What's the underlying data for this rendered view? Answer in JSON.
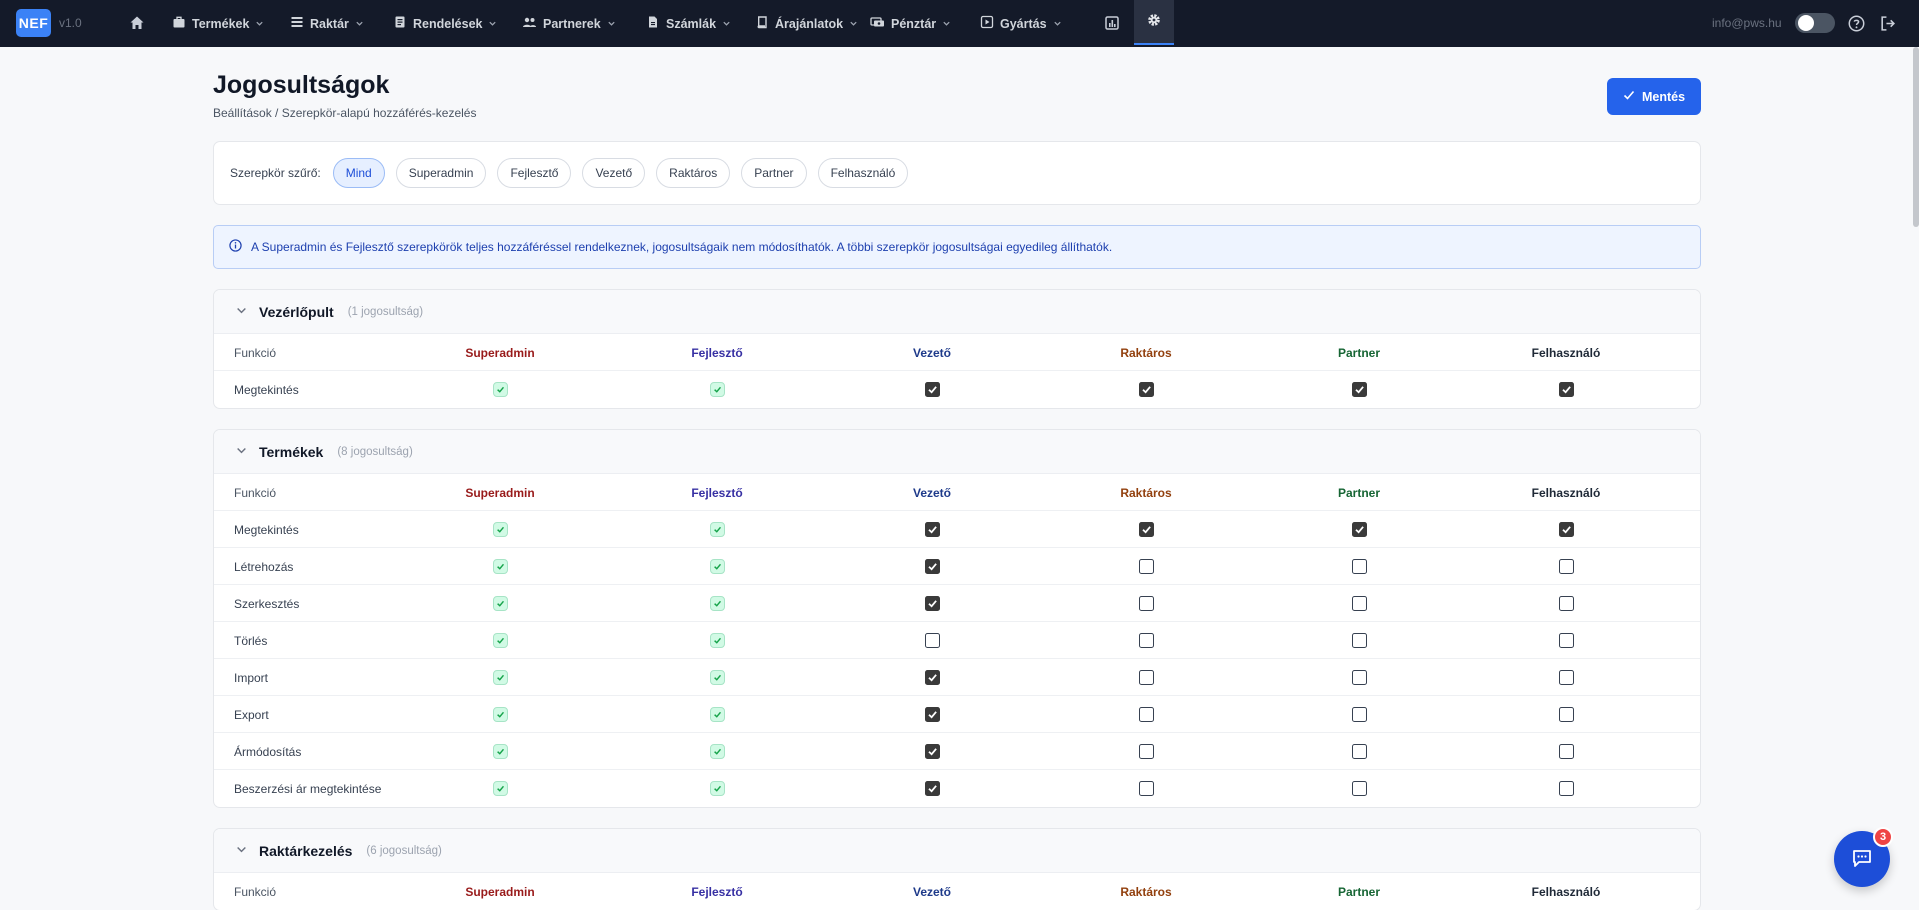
{
  "nav": {
    "logo": "NEF",
    "version": "v1.0",
    "items": [
      {
        "label": "Termékek",
        "icon": "box-icon"
      },
      {
        "label": "Raktár",
        "icon": "list-icon"
      },
      {
        "label": "Rendelések",
        "icon": "document-icon"
      },
      {
        "label": "Partnerek",
        "icon": "users-icon"
      },
      {
        "label": "Számlák",
        "icon": "file-icon"
      },
      {
        "label": "Árajánlatok",
        "icon": "book-icon"
      },
      {
        "label": "Pénztár",
        "icon": "cash-icon"
      },
      {
        "label": "Gyártás",
        "icon": "play-icon"
      }
    ],
    "user_email": "info@pws.hu"
  },
  "page": {
    "title": "Jogosultságok",
    "breadcrumb": "Beállítások / Szerepkör-alapú hozzáférés-kezelés",
    "save_label": "Mentés"
  },
  "filter": {
    "label": "Szerepkör szűrő:",
    "chips": [
      "Mind",
      "Superadmin",
      "Fejlesztő",
      "Vezető",
      "Raktáros",
      "Partner",
      "Felhasználó"
    ],
    "active": "Mind"
  },
  "info_text": "A Superadmin és Fejlesztő szerepkörök teljes hozzáféréssel rendelkeznek, jogosultságaik nem módosíthatók. A többi szerepkör jogosultságai egyedileg állíthatók.",
  "table_header": {
    "func": "Funkció",
    "roles": [
      "Superadmin",
      "Fejlesztő",
      "Vezető",
      "Raktáros",
      "Partner",
      "Felhasználó"
    ]
  },
  "sections": [
    {
      "title": "Vezérlőpult",
      "count": "(1 jogosultság)",
      "rows": [
        {
          "label": "Megtekintés",
          "vezeto": true,
          "raktaros": true,
          "partner": true,
          "felhasznalo": true
        }
      ]
    },
    {
      "title": "Termékek",
      "count": "(8 jogosultság)",
      "rows": [
        {
          "label": "Megtekintés",
          "vezeto": true,
          "raktaros": true,
          "partner": true,
          "felhasznalo": true
        },
        {
          "label": "Létrehozás",
          "vezeto": true,
          "raktaros": false,
          "partner": false,
          "felhasznalo": false
        },
        {
          "label": "Szerkesztés",
          "vezeto": true,
          "raktaros": false,
          "partner": false,
          "felhasznalo": false
        },
        {
          "label": "Törlés",
          "vezeto": false,
          "raktaros": false,
          "partner": false,
          "felhasznalo": false
        },
        {
          "label": "Import",
          "vezeto": true,
          "raktaros": false,
          "partner": false,
          "felhasznalo": false
        },
        {
          "label": "Export",
          "vezeto": true,
          "raktaros": false,
          "partner": false,
          "felhasznalo": false
        },
        {
          "label": "Ármódosítás",
          "vezeto": true,
          "raktaros": false,
          "partner": false,
          "felhasznalo": false
        },
        {
          "label": "Beszerzési ár megtekintése",
          "vezeto": true,
          "raktaros": false,
          "partner": false,
          "felhasznalo": false
        }
      ]
    },
    {
      "title": "Raktárkezelés",
      "count": "(6 jogosultság)",
      "rows": []
    }
  ],
  "chat": {
    "badge": "3"
  }
}
